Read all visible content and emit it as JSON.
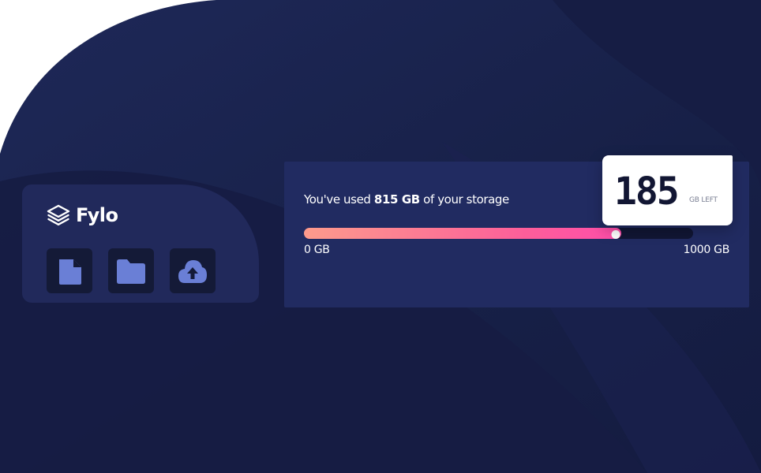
{
  "app": {
    "brand_name": "Fylo",
    "brand_icon": "stacked-layers-icon"
  },
  "toolbar": {
    "buttons": [
      {
        "name": "document-button",
        "icon": "document-icon"
      },
      {
        "name": "folder-button",
        "icon": "folder-icon"
      },
      {
        "name": "upload-button",
        "icon": "cloud-upload-icon"
      }
    ]
  },
  "storage": {
    "usage_prefix": "You've used ",
    "used_amount": "815 GB",
    "usage_suffix": " of your storage",
    "scale_min": "0 GB",
    "scale_max": "1000 GB",
    "used_fraction": 0.815,
    "remaining_value": "185",
    "remaining_unit": "GB LEFT"
  },
  "colors": {
    "page_bg": "#181f4a",
    "card_bg": "#212b61",
    "icon_tile_bg": "#141a37",
    "icon_color": "#6a7fd6",
    "progress_start": "#fd9b8c",
    "progress_end": "#ff4eaa",
    "badge_bg": "#ffffff",
    "badge_text": "#121633"
  }
}
